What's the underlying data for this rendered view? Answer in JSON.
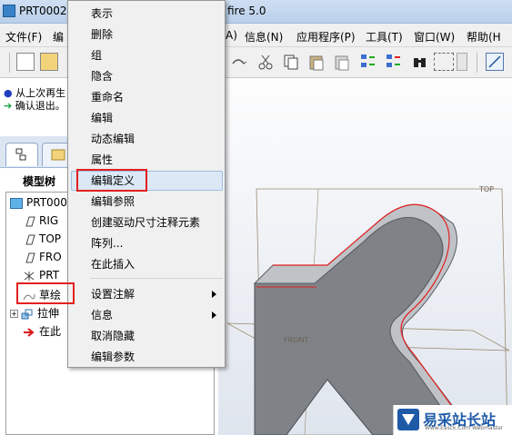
{
  "window": {
    "title_left": "PRT0002",
    "title_right": "fire 5.0"
  },
  "menubar": {
    "items": [
      "文件(F)",
      "编",
      "A)",
      "信息(N)",
      "应用程序(P)",
      "工具(T)",
      "窗口(W)",
      "帮助(H"
    ]
  },
  "messages": [
    {
      "bullet": "●",
      "text": "从上次再生"
    },
    {
      "bullet": "➔",
      "text": "确认退出。"
    }
  ],
  "model_tree": {
    "title": "模型树",
    "items": [
      {
        "label": "PRT000",
        "icon": "part-icon"
      },
      {
        "label": "RIG",
        "icon": "datum-plane-icon"
      },
      {
        "label": "TOP",
        "icon": "datum-plane-icon"
      },
      {
        "label": "FRO",
        "icon": "datum-plane-icon"
      },
      {
        "label": "PRT",
        "icon": "csys-icon"
      },
      {
        "label": "草绘",
        "icon": "sketch-icon"
      },
      {
        "label": "拉伸",
        "icon": "extrude-icon"
      },
      {
        "label": "在此",
        "icon": "insert-here-icon"
      }
    ]
  },
  "context_menu": {
    "items": [
      {
        "label": "表示"
      },
      {
        "label": "删除"
      },
      {
        "label": "组"
      },
      {
        "label": "隐含"
      },
      {
        "label": "重命名"
      },
      {
        "label": "编辑"
      },
      {
        "label": "动态编辑"
      },
      {
        "label": "属性"
      },
      {
        "label": "编辑定义",
        "highlighted": true
      },
      {
        "label": "编辑参照"
      },
      {
        "label": "创建驱动尺寸注释元素"
      },
      {
        "label": "阵列..."
      },
      {
        "label": "在此插入"
      },
      {
        "label": "设置注解",
        "submenu": true
      },
      {
        "label": "信息",
        "submenu": true
      },
      {
        "label": "取消隐藏"
      },
      {
        "label": "编辑参数"
      }
    ]
  },
  "graphics": {
    "plane_labels": {
      "top": "TOP",
      "front": "FRONT"
    }
  },
  "watermark": {
    "text": "易采站长站",
    "sub": "Www.Easck.Com Webmaster"
  },
  "colors": {
    "highlight_red": "#e41f1f",
    "menu_highlight": "#dce8f6",
    "model_gray": "#8c9096"
  }
}
